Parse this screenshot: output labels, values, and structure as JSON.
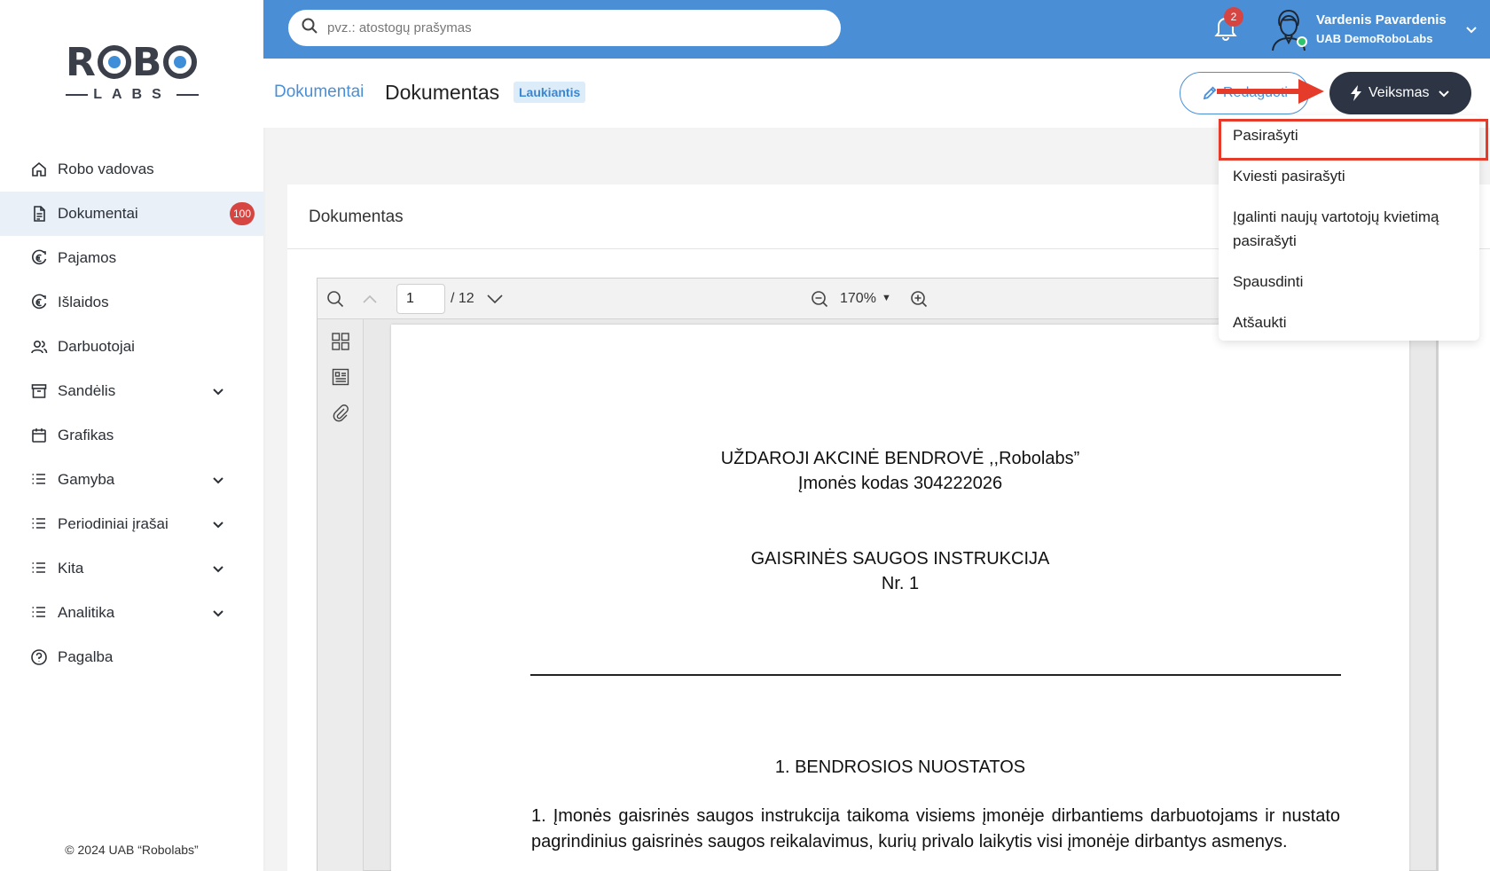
{
  "brand": {
    "logo_top": "ROBO",
    "logo_bottom": "LABS"
  },
  "sidebar": {
    "items": [
      {
        "label": "Robo vadovas",
        "icon": "home-icon"
      },
      {
        "label": "Dokumentai",
        "icon": "document-icon",
        "badge": "100",
        "active": true
      },
      {
        "label": "Pajamos",
        "icon": "income-icon"
      },
      {
        "label": "Išlaidos",
        "icon": "expenses-icon"
      },
      {
        "label": "Darbuotojai",
        "icon": "users-icon"
      },
      {
        "label": "Sandėlis",
        "icon": "archive-icon",
        "expandable": true
      },
      {
        "label": "Grafikas",
        "icon": "calendar-icon"
      },
      {
        "label": "Gamyba",
        "icon": "list-icon",
        "expandable": true
      },
      {
        "label": "Periodiniai įrašai",
        "icon": "list-icon",
        "expandable": true
      },
      {
        "label": "Kita",
        "icon": "list-icon",
        "expandable": true
      },
      {
        "label": "Analitika",
        "icon": "list-icon",
        "expandable": true
      },
      {
        "label": "Pagalba",
        "icon": "help-icon"
      }
    ],
    "copyright": "© 2024 UAB “Robolabs”"
  },
  "topbar": {
    "search_placeholder": "pvz.: atostogų prašymas",
    "notifications_count": "2",
    "user_name": "Vardenis Pavardenis",
    "user_company": "UAB DemoRoboLabs",
    "accent_color": "#4a8fd6"
  },
  "header": {
    "breadcrumb": "Dokumentai",
    "title": "Dokumentas",
    "status": "Laukiantis",
    "edit_label": "Redaguoti",
    "action_label": "Veiksmas"
  },
  "action_menu": {
    "items": [
      "Pasirašyti",
      "Kviesti pasirašyti",
      "Įgalinti naujų vartotojų kvietimą",
      "pasirašyti",
      "Spausdinti",
      "Atšaukti"
    ]
  },
  "card": {
    "title": "Dokumentas"
  },
  "viewer": {
    "current_page": "1",
    "total_pages": "/ 12",
    "zoom": "170%",
    "zoom_caret": "▼"
  },
  "document": {
    "company_line": "UŽDAROJI AKCINĖ BENDROVĖ ,,Robolabs”",
    "code_line": "Įmonės kodas  304222026",
    "title_line": "GAISRINĖS SAUGOS INSTRUKCIJA",
    "number_line": "Nr. 1",
    "section_heading": "1.  BENDROSIOS NUOSTATOS",
    "paragraph_1": "1. Įmonės gaisrinės saugos instrukcija taikoma visiems įmonėje dirbantiems darbuotojams ir nustato pagrindinius gaisrinės saugos reikalavimus, kurių privalo laikytis visi įmonėje dirbantys asmenys."
  },
  "annotation": {
    "highlight_color": "#e53b2b"
  }
}
